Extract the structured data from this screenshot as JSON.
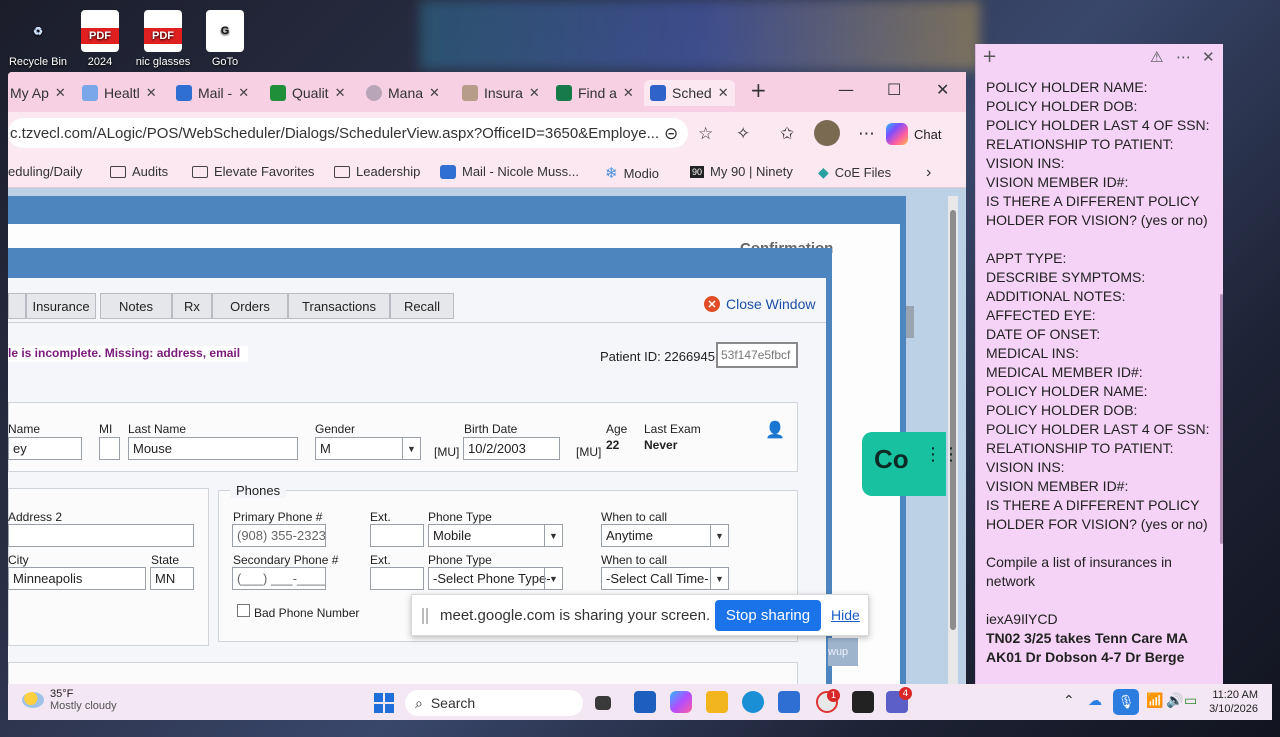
{
  "desktop": {
    "icons": [
      {
        "label": "Recycle Bin"
      },
      {
        "label": "2024"
      },
      {
        "label": "nic glasses"
      },
      {
        "label": "GoTo"
      }
    ]
  },
  "browser": {
    "tabs": [
      {
        "label": "My Ap"
      },
      {
        "label": "Healtl"
      },
      {
        "label": "Mail -"
      },
      {
        "label": "Qualit"
      },
      {
        "label": "Mana"
      },
      {
        "label": "Insura"
      },
      {
        "label": "Find a"
      },
      {
        "label": "Sched"
      }
    ],
    "url": "c.tzvecl.com/ALogic/POS/WebScheduler/Dialogs/SchedulerView.aspx?OfficeID=3650&Employe...",
    "chat_label": "Chat",
    "bookmarks": [
      {
        "label": "eduling/Daily"
      },
      {
        "label": "Audits"
      },
      {
        "label": "Elevate Favorites"
      },
      {
        "label": "Leadership"
      },
      {
        "label": "Mail - Nicole Muss..."
      },
      {
        "label": "Modio"
      },
      {
        "label": "My 90 | Ninety"
      },
      {
        "label": "CoE Files"
      }
    ]
  },
  "scheduler": {
    "ghost_title": "Confirmation",
    "tabs": [
      {
        "label": "Insurance"
      },
      {
        "label": "Notes"
      },
      {
        "label": "Rx"
      },
      {
        "label": "Orders"
      },
      {
        "label": "Transactions"
      },
      {
        "label": "Recall"
      }
    ],
    "close_window": "Close Window",
    "warning": "le is incomplete. Missing: address, email",
    "patient_id_label": "Patient ID: 2266945",
    "patient_id_code": "53f147e5fbcf",
    "name": {
      "first_label": "Name",
      "first_value": "ey",
      "mi_label": "MI",
      "last_label": "Last Name",
      "last_value": "Mouse",
      "gender_label": "Gender",
      "gender_value": "M",
      "mu1": "[MU]",
      "birth_label": "Birth Date",
      "birth_value": "10/2/2003",
      "mu2": "[MU]",
      "age_label": "Age",
      "age_value": "22",
      "last_exam_label": "Last Exam",
      "last_exam_value": "Never"
    },
    "address": {
      "address2_label": "Address 2",
      "city_label": "City",
      "city_value": "Minneapolis",
      "state_label": "State",
      "state_value": "MN"
    },
    "phones": {
      "legend": "Phones",
      "primary_label": "Primary Phone #",
      "primary_value": "(908) 355-2323",
      "ext_label": "Ext.",
      "type_label": "Phone Type",
      "type_value": "Mobile",
      "when_label": "When to call",
      "when_value": "Anytime",
      "secondary_label": "Secondary Phone #",
      "secondary_value": "(___) ___-____",
      "ext2_label": "Ext.",
      "type2_label": "Phone Type",
      "type2_value": "-Select Phone Type-",
      "when2_label": "When to call",
      "when2_value": "-Select Call Time-",
      "bad_phone_label": "Bad Phone Number"
    },
    "ghost_button": "wup"
  },
  "share_bar": {
    "message": "meet.google.com is sharing your screen.",
    "stop": "Stop sharing",
    "hide": "Hide"
  },
  "note": {
    "lines": [
      "POLICY HOLDER NAME:",
      "POLICY HOLDER DOB:",
      "POLICY HOLDER LAST 4 OF SSN:",
      "RELATIONSHIP TO PATIENT:",
      "VISION INS:",
      "VISION MEMBER ID#:",
      "IS THERE A DIFFERENT POLICY",
      "HOLDER FOR VISION? (yes or no)",
      "",
      "APPT TYPE:",
      "DESCRIBE SYMPTOMS:",
      "ADDITIONAL NOTES:",
      "AFFECTED EYE:",
      "DATE OF ONSET:",
      "MEDICAL INS:",
      "MEDICAL MEMBER ID#:",
      "POLICY HOLDER NAME:",
      "POLICY HOLDER DOB:",
      "POLICY HOLDER LAST 4 OF SSN:",
      "RELATIONSHIP TO PATIENT:",
      "VISION INS:",
      "VISION MEMBER ID#:",
      "IS THERE A DIFFERENT POLICY",
      "HOLDER FOR VISION? (yes or no)",
      "",
      "Compile a list of insurances in",
      "network",
      "",
      "iexA9IlYCD"
    ],
    "bold_lines": [
      "TN02 3/25 takes Tenn Care MA",
      "AK01 Dr Dobson 4-7 Dr Berge"
    ]
  },
  "taskbar": {
    "weather_temp": "35°F",
    "weather_desc": "Mostly cloudy",
    "search_label": "Search",
    "badge_1": "1",
    "badge_2": "4",
    "time": "11:20 AM",
    "date": "3/10/2026"
  }
}
